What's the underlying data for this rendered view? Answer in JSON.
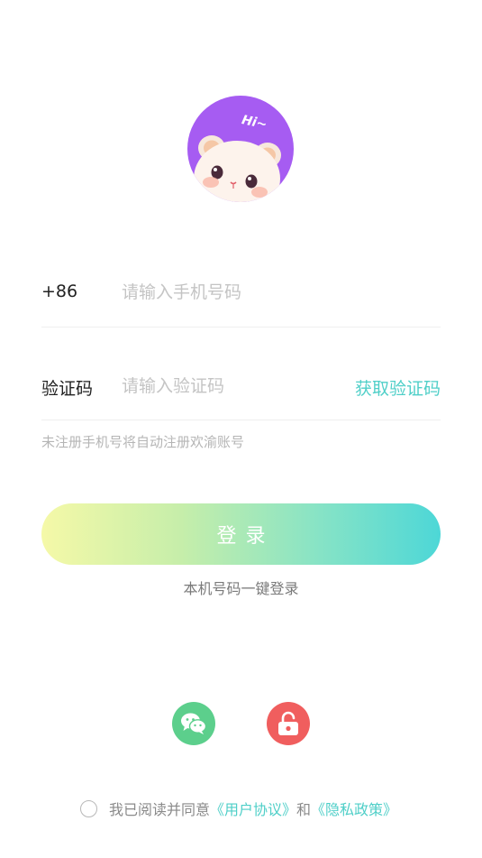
{
  "avatar": {
    "bubble_text": "Hi~"
  },
  "phone": {
    "country_code": "+86",
    "placeholder": "请输入手机号码",
    "value": ""
  },
  "code": {
    "label": "验证码",
    "placeholder": "请输入验证码",
    "value": "",
    "get_code_label": "获取验证码"
  },
  "hint": "未注册手机号将自动注册欢渝账号",
  "login_label": "登录",
  "one_key_login_label": "本机号码一键登录",
  "social": {
    "wechat_icon": "wechat-icon",
    "lock_icon": "unlock-icon"
  },
  "agreement": {
    "prefix": "我已阅读并同意",
    "user_agreement": "《用户协议》",
    "connector": "和",
    "privacy_policy": "《隐私政策》",
    "checked": false
  },
  "colors": {
    "accent": "#4fcfc8",
    "gradient_start": "#f5f9a8",
    "gradient_end": "#4dd7d7",
    "wechat": "#5ccf8c",
    "lock": "#f05e5e",
    "avatar_bg": "#a65cf2"
  }
}
